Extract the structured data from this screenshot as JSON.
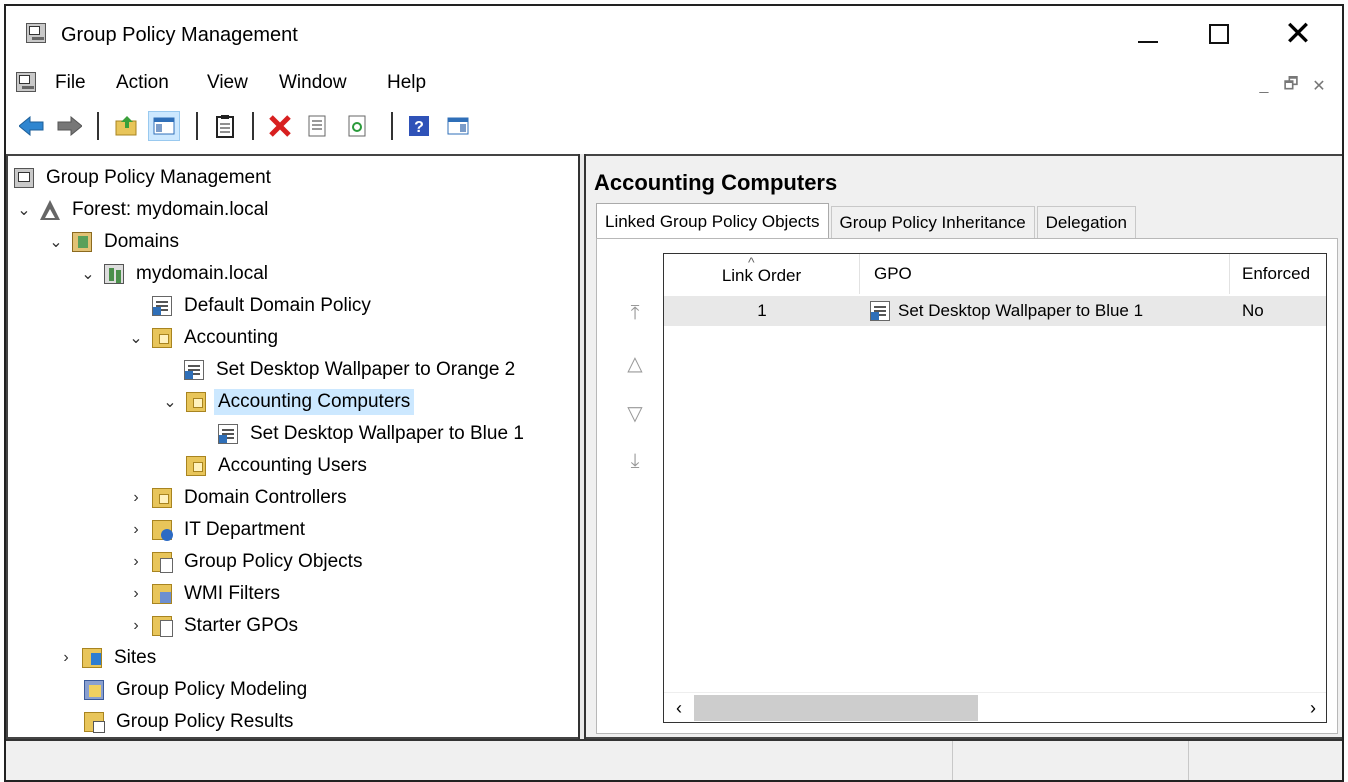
{
  "window": {
    "title": "Group Policy Management",
    "controls": {
      "minimize": "minimize-icon",
      "maximize": "maximize-icon",
      "close": "✕"
    }
  },
  "menu": [
    "File",
    "Action",
    "View",
    "Window",
    "Help"
  ],
  "mdi_controls": [
    "_",
    "🗗",
    "✕"
  ],
  "toolbar": [
    "back-icon",
    "forward-icon",
    "up-folder-icon",
    "show-hide-tree-icon",
    "clipboard-icon",
    "delete-icon",
    "properties-icon",
    "refresh-icon",
    "help-icon",
    "show-hide-action-pane-icon"
  ],
  "tree": {
    "root": "Group Policy Management",
    "forest": "Forest: mydomain.local",
    "domains": "Domains",
    "domain": "mydomain.local",
    "default_policy": "Default Domain Policy",
    "accounting": "Accounting",
    "gpo_orange": "Set Desktop Wallpaper to Orange 2",
    "accounting_computers": "Accounting Computers",
    "gpo_blue": "Set Desktop Wallpaper to Blue 1",
    "accounting_users": "Accounting Users",
    "domain_controllers": "Domain Controllers",
    "it_department": "IT Department",
    "group_policy_objects": "Group Policy Objects",
    "wmi_filters": "WMI Filters",
    "starter_gpos": "Starter GPOs",
    "sites": "Sites",
    "modeling": "Group Policy Modeling",
    "results": "Group Policy Results"
  },
  "details": {
    "title": "Accounting Computers",
    "tabs": [
      "Linked Group Policy Objects",
      "Group Policy Inheritance",
      "Delegation"
    ],
    "columns": [
      "Link Order",
      "GPO",
      "Enforced"
    ],
    "rows": [
      {
        "link_order": "1",
        "gpo": "Set Desktop Wallpaper to Blue 1",
        "enforced": "No"
      }
    ],
    "order_buttons": [
      "⤒",
      "△",
      "▽",
      "⤓"
    ],
    "scroll_left": "‹",
    "scroll_right": "›"
  }
}
